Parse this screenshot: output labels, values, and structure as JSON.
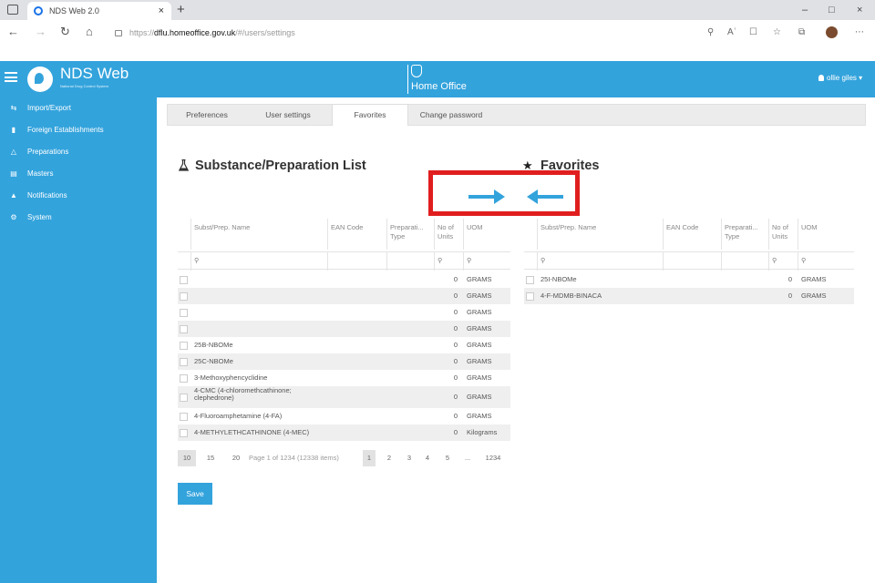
{
  "browser": {
    "tab_title": "NDS Web 2.0",
    "tab_close": "×",
    "new_tab": "+",
    "url_prefix": "https://",
    "url_host": "dflu.homeoffice.gov.uk",
    "url_path": "/#/users/settings",
    "window_controls": [
      "–",
      "□",
      "×"
    ]
  },
  "header": {
    "title": "NDS Web",
    "subtitle": "National Drug Control System",
    "brand": "Home Office",
    "user": "ollie giles"
  },
  "sidebar": {
    "items": [
      {
        "label": "Import/Export",
        "icon": "swap-icon"
      },
      {
        "label": "Foreign Establishments",
        "icon": "book-icon"
      },
      {
        "label": "Preparations",
        "icon": "flask-icon"
      },
      {
        "label": "Masters",
        "icon": "list-icon"
      },
      {
        "label": "Notifications",
        "icon": "bell-icon"
      },
      {
        "label": "System",
        "icon": "gear-icon"
      }
    ]
  },
  "tabs": {
    "preferences": "Preferences",
    "user_settings": "User settings",
    "favorites": "Favorites",
    "change_password": "Change password",
    "active": "Favorites"
  },
  "substance_list": {
    "title": "Substance/Preparation List",
    "columns": {
      "name": "Subst/Prep. Name",
      "ean": "EAN Code",
      "type": "Preparati... Type",
      "units": "No of Units",
      "uom": "UOM"
    },
    "rows": [
      {
        "name": "",
        "ean": "",
        "type": "",
        "units": "0",
        "uom": "GRAMS"
      },
      {
        "name": "",
        "ean": "",
        "type": "",
        "units": "0",
        "uom": "GRAMS"
      },
      {
        "name": "",
        "ean": "",
        "type": "",
        "units": "0",
        "uom": "GRAMS"
      },
      {
        "name": "",
        "ean": "",
        "type": "",
        "units": "0",
        "uom": "GRAMS"
      },
      {
        "name": "25B-NBOMe",
        "ean": "",
        "type": "",
        "units": "0",
        "uom": "GRAMS"
      },
      {
        "name": "25C-NBOMe",
        "ean": "",
        "type": "",
        "units": "0",
        "uom": "GRAMS"
      },
      {
        "name": "3-Methoxyphencyclidine",
        "ean": "",
        "type": "",
        "units": "0",
        "uom": "GRAMS"
      },
      {
        "name": "4-CMC (4-chloromethcathinone; clephedrone)",
        "ean": "",
        "type": "",
        "units": "0",
        "uom": "GRAMS"
      },
      {
        "name": "4-Fluoroamphetamine (4-FA)",
        "ean": "",
        "type": "",
        "units": "0",
        "uom": "GRAMS"
      },
      {
        "name": "4-METHYLETHCATHINONE (4-MEC)",
        "ean": "",
        "type": "",
        "units": "0",
        "uom": "Kilograms"
      }
    ]
  },
  "favorites": {
    "title": "Favorites",
    "columns": {
      "name": "Subst/Prep. Name",
      "ean": "EAN Code",
      "type": "Preparati... Type",
      "units": "No of Units",
      "uom": "UOM"
    },
    "rows": [
      {
        "name": "25I-NBOMe",
        "ean": "",
        "type": "",
        "units": "0",
        "uom": "GRAMS"
      },
      {
        "name": "4-F-MDMB-BINACA",
        "ean": "",
        "type": "",
        "units": "0",
        "uom": "GRAMS"
      }
    ]
  },
  "pager": {
    "sizes": [
      "10",
      "15",
      "20"
    ],
    "info": "Page 1 of 1234 (12338 items)",
    "pages": [
      "1",
      "2",
      "3",
      "4",
      "5",
      "...",
      "1234"
    ]
  },
  "save_label": "Save",
  "colors": {
    "brand": "#33a3dc",
    "highlight": "#e01e1e"
  }
}
